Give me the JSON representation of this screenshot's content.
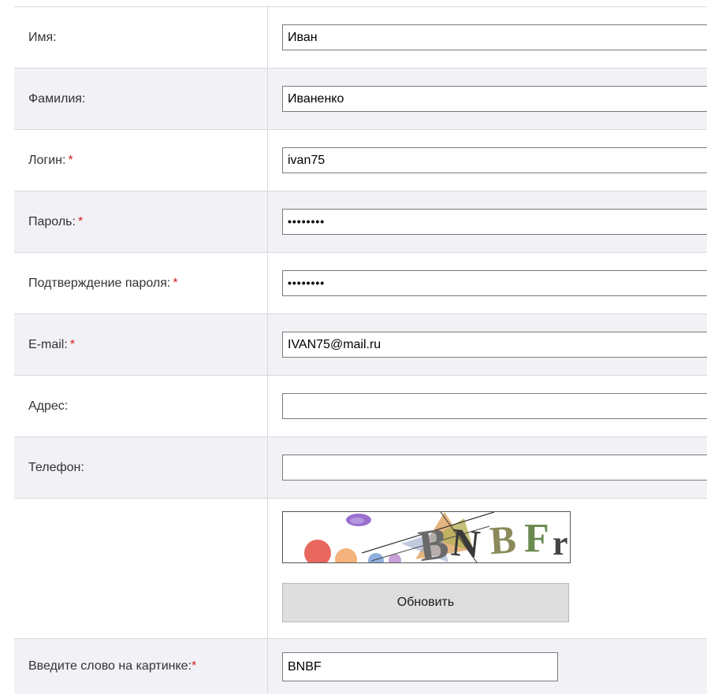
{
  "form": {
    "rows": [
      {
        "label": "Имя:",
        "required": false,
        "value": "Иван"
      },
      {
        "label": "Фамилия:",
        "required": false,
        "value": "Иваненко"
      },
      {
        "label": "Логин:",
        "required": true,
        "value": "ivan75"
      },
      {
        "label": "Пароль:",
        "required": true,
        "value": "••••••••"
      },
      {
        "label": "Подтверждение пароля:",
        "required": true,
        "value": "••••••••"
      },
      {
        "label": "E-mail:",
        "required": true,
        "value": "IVAN75@mail.ru"
      },
      {
        "label": "Адрес:",
        "required": false,
        "value": ""
      },
      {
        "label": "Телефон:",
        "required": false,
        "value": ""
      }
    ],
    "required_mark": "*",
    "captcha": {
      "image_text": "BNBF",
      "refresh_label": "Обновить",
      "input_label": "Введите слово на картинке:",
      "input_value": "BNBF"
    }
  },
  "colors": {
    "alt_row": "#f1f1f6",
    "border": "#d8d8df",
    "required": "#d42020",
    "button_bg": "#dedede"
  }
}
